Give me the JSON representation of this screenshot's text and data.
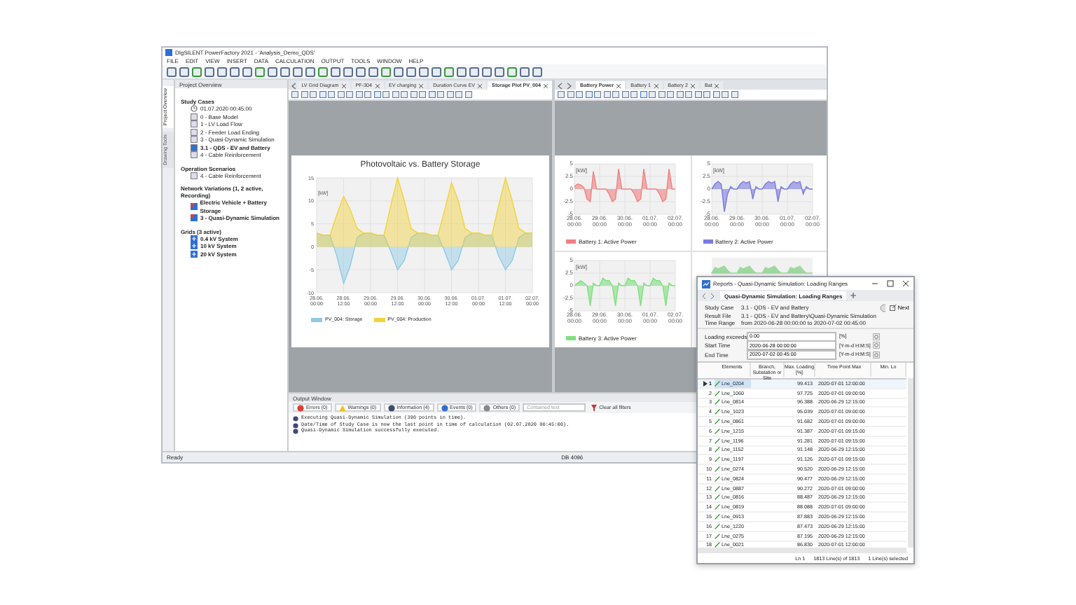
{
  "window": {
    "title": "DIgSILENT PowerFactory 2021 - 'Analysis_Demo_QDS'",
    "menu": [
      "FILE",
      "EDIT",
      "VIEW",
      "INSERT",
      "DATA",
      "CALCULATION",
      "OUTPUT",
      "TOOLS",
      "WINDOW",
      "HELP"
    ]
  },
  "project_overview": {
    "title": "Project Overview",
    "side_tabs": [
      {
        "label": "Project Overview",
        "selected": true
      },
      {
        "label": "Drawing Tools",
        "selected": false
      }
    ],
    "groups": [
      {
        "label": "Study Cases",
        "items": [
          {
            "label": "01.07.2020 00:45:00",
            "kind": "clock",
            "active": false
          },
          {
            "label": "0 - Base Model",
            "kind": "case",
            "active": false
          },
          {
            "label": "1 - LV Load Flow",
            "kind": "case",
            "active": false
          },
          {
            "label": "2 - Feeder Load Ending",
            "kind": "case",
            "active": false
          },
          {
            "label": "3 - Quasi-Dynamic Simulation",
            "kind": "case",
            "active": false
          },
          {
            "label": "3.1 - QDS - EV and Battery",
            "kind": "case",
            "active": true
          },
          {
            "label": "4 - Cable Reinforcement",
            "kind": "case",
            "active": false
          }
        ]
      },
      {
        "label": "Operation Scenarios",
        "items": [
          {
            "label": "4 - Cable Reinforcement",
            "kind": "case",
            "active": false
          }
        ]
      },
      {
        "label": "Network Variations (1, 2 active, Recording)",
        "items": [
          {
            "label": "Electric Vehicle + Battery Storage",
            "kind": "variation",
            "active": true
          },
          {
            "label": "3 - Quasi-Dynamic Simulation",
            "kind": "variation",
            "active": true
          }
        ]
      },
      {
        "label": "Grids (3 active)",
        "items": [
          {
            "label": "0.4 kV System",
            "kind": "grid",
            "active": true
          },
          {
            "label": "10 kV System",
            "kind": "grid",
            "active": true
          },
          {
            "label": "20 kV System",
            "kind": "grid",
            "active": true
          }
        ]
      }
    ]
  },
  "left_pane": {
    "tabs": [
      {
        "label": "LV Grid Diagram",
        "selected": false
      },
      {
        "label": "PF-304",
        "selected": false
      },
      {
        "label": "EV charging",
        "selected": false
      },
      {
        "label": "Duration Curve EV",
        "selected": false
      },
      {
        "label": "Storage Plot PV_004",
        "selected": true
      }
    ],
    "plot": {
      "title": "Photovoltaic vs. Battery Storage",
      "chart_data": {
        "type": "area",
        "grid": true,
        "ylabel": "[kW]",
        "ylim": [
          -10,
          15
        ],
        "yticks": [
          -10,
          -5,
          0,
          5,
          10,
          15
        ],
        "categories": [
          "28.06. 00:00",
          null,
          null,
          null,
          "28.06. 12:00",
          null,
          null,
          null,
          "29.06. 00:00",
          null,
          null,
          null,
          "29.06. 12:00",
          null,
          null,
          null,
          "30.06. 00:00",
          null,
          null,
          null,
          "30.06. 12:00",
          null,
          null,
          null,
          "01.07. 00:00",
          null,
          null,
          null,
          "01.07. 12:00",
          null,
          null,
          null,
          "02.07. 00:00"
        ],
        "series": [
          {
            "name": "PV_004: Storage",
            "color": "#8ecae6",
            "values": [
              3,
              2.5,
              2.5,
              -2,
              -8,
              -4,
              2,
              3,
              3,
              2.5,
              2.5,
              -1,
              -5,
              -3,
              2,
              3,
              3,
              2.5,
              2.5,
              -1,
              -5,
              -3,
              2,
              3,
              3,
              2.5,
              2.5,
              -2,
              -5,
              -3,
              2,
              3,
              3
            ]
          },
          {
            "name": "PV_004: Production",
            "color": "#f2d23c",
            "values": [
              3,
              2.5,
              2.5,
              7,
              11,
              8,
              4,
              3,
              3,
              2.5,
              2.5,
              9,
              15,
              10,
              4,
              3,
              3,
              2.5,
              2.5,
              8,
              14,
              10,
              4,
              3,
              3,
              2.5,
              2.5,
              9,
              15,
              10,
              4,
              3,
              3
            ]
          }
        ]
      }
    }
  },
  "right_pane": {
    "tabs": [
      {
        "label": "Battery Power",
        "selected": true
      },
      {
        "label": "Battery 1",
        "selected": false
      },
      {
        "label": "Battery 2",
        "selected": false
      },
      {
        "label": "Bat",
        "selected": false
      }
    ],
    "plots": [
      {
        "chart_data": {
          "type": "area",
          "grid": true,
          "ylabel": "[kW]",
          "ylim": [
            -5,
            5
          ],
          "yticks": [
            -5,
            -2.5,
            0,
            2.5,
            5
          ],
          "categories": [
            "28.06. 00:00",
            null,
            null,
            null,
            null,
            null,
            null,
            null,
            "29.06. 00:00",
            null,
            null,
            null,
            null,
            null,
            null,
            null,
            "30.06. 00:00",
            null,
            null,
            null,
            null,
            null,
            null,
            null,
            "01.07. 00:00",
            null,
            null,
            null,
            null,
            null,
            null,
            null,
            "02.07. 00:00"
          ],
          "series": [
            {
              "name": "Battery 1: Active Power",
              "color": "#f08080",
              "values": [
                0.5,
                1,
                0.8,
                0.3,
                -2,
                -2.5,
                3.5,
                0,
                0,
                0,
                0,
                -1,
                -2.5,
                -2,
                4,
                0,
                0,
                0,
                0,
                -1,
                -2.5,
                -2,
                4,
                0,
                0,
                0,
                0,
                -1,
                -2.5,
                -2,
                4,
                0,
                0
              ]
            }
          ]
        }
      },
      {
        "chart_data": {
          "type": "area",
          "grid": true,
          "ylabel": "[kW]",
          "ylim": [
            -5,
            5
          ],
          "yticks": [
            -5,
            -2.5,
            0,
            2.5,
            5
          ],
          "categories": [
            "28.06. 00:00",
            null,
            null,
            null,
            null,
            null,
            null,
            null,
            "29.06. 00:00",
            null,
            null,
            null,
            null,
            null,
            null,
            null,
            "30.06. 00:00",
            null,
            null,
            null,
            null,
            null,
            null,
            null,
            "01.07. 00:00",
            null,
            null,
            null,
            null,
            null,
            null,
            null,
            "02.07. 00:00"
          ],
          "series": [
            {
              "name": "Battery 2: Active Power",
              "color": "#7b7be0",
              "values": [
                0,
                1,
                1.5,
                1,
                -4.5,
                -1,
                0.5,
                0,
                0,
                1,
                1.5,
                1.2,
                1.5,
                -2,
                0.5,
                0,
                0,
                1,
                1.5,
                1.2,
                1.5,
                -2.5,
                0.5,
                0,
                0,
                1,
                1.5,
                1.2,
                1.5,
                -1,
                0.5,
                0,
                0
              ]
            }
          ]
        }
      },
      {
        "chart_data": {
          "type": "area",
          "grid": true,
          "ylabel": "[kW]",
          "ylim": [
            -5,
            5
          ],
          "yticks": [
            -5,
            -2.5,
            0,
            2.5,
            5
          ],
          "categories": [
            "28.06. 00:00",
            null,
            null,
            null,
            null,
            null,
            null,
            null,
            "29.06. 00:00",
            null,
            null,
            null,
            null,
            null,
            null,
            null,
            "30.06. 00:00",
            null,
            null,
            null,
            null,
            null,
            null,
            null,
            "01.07. 00:00",
            null,
            null,
            null,
            null,
            null,
            null,
            null,
            "02.07. 00:00"
          ],
          "series": [
            {
              "name": "Battery 3: Active Power",
              "color": "#7ee07e",
              "values": [
                0,
                0.5,
                1,
                0.5,
                0,
                -4,
                0.5,
                0,
                0,
                1.5,
                1,
                1,
                0,
                -4,
                0.5,
                0,
                0,
                1.5,
                1,
                1,
                0,
                -4,
                0.5,
                0,
                0,
                1.5,
                1,
                1,
                0,
                -4,
                0.5,
                0,
                0
              ]
            }
          ]
        }
      }
    ],
    "covered_plot": {
      "color": "#9fd89f"
    }
  },
  "output": {
    "title": "Output Window",
    "filters": [
      {
        "label": "Errors (0)",
        "kind": "error"
      },
      {
        "label": "Warnings (0)",
        "kind": "warning"
      },
      {
        "label": "Information (4)",
        "kind": "info"
      },
      {
        "label": "Events (0)",
        "kind": "event"
      },
      {
        "label": "Others (0)",
        "kind": "other"
      }
    ],
    "search_placeholder": "Contained text",
    "clear_label": "Clear all filters",
    "messages": [
      "Executing Quasi-Dynamic Simulation (390 points in time).",
      "Date/Time of Study Case is now the last point in time of calculation (02.07.2020 00:45:00).",
      "Quasi-Dynamic Simulation successfully executed."
    ]
  },
  "status_bar": {
    "left": "Ready",
    "right": "DB 4096"
  },
  "report": {
    "title": "Reports - Quasi-Dynamic Simulation: Loading Ranges",
    "tab": {
      "label": "Quasi-Dynamic Simulation: Loading Ranges",
      "selected": true
    },
    "next_label": "Next",
    "info": [
      {
        "label": "Study Case",
        "value": "3.1 - QDS - EV and Battery"
      },
      {
        "label": "Result File",
        "value": "3.1 - QDS - EV and Battery\\Quasi-Dynamic Simulation"
      },
      {
        "label": "Time Range",
        "value": "from 2020-06-28 00:00:00 to 2020-07-02 00:45:00"
      }
    ],
    "fields": [
      {
        "label": "Loading exceeds",
        "value": "0.00",
        "unit": "[%]"
      },
      {
        "label": "Start Time",
        "value": "2020-06-28 00:00:00",
        "unit": "[Y-m-d H:M:S]"
      },
      {
        "label": "End Time",
        "value": "2020-07-02 00:45:00",
        "unit": "[Y-m-d H:M:S]"
      }
    ],
    "columns": [
      "Elements",
      "Branch, Substation or Site",
      "Max. Loading [%]",
      "Time Point Max",
      "Min. Lo"
    ],
    "rows": [
      {
        "n": "1",
        "element": "Lne_0204",
        "max": "99.413",
        "time": "2020-07-01 12:00:00",
        "selected": true
      },
      {
        "n": "2",
        "element": "Lne_1060",
        "max": "97.725",
        "time": "2020-07-01 09:00:00",
        "selected": false
      },
      {
        "n": "3",
        "element": "Lne_0814",
        "max": "96.388",
        "time": "2020-06-29 12:15:00",
        "selected": false
      },
      {
        "n": "4",
        "element": "Lne_1023",
        "max": "95.039",
        "time": "2020-07-01 09:00:00",
        "selected": false
      },
      {
        "n": "5",
        "element": "Lne_0861",
        "max": "91.682",
        "time": "2020-07-01 09:00:00",
        "selected": false
      },
      {
        "n": "6",
        "element": "Lne_1215",
        "max": "91.387",
        "time": "2020-07-01 09:15:00",
        "selected": false
      },
      {
        "n": "7",
        "element": "Lne_1196",
        "max": "91.281",
        "time": "2020-07-01 09:15:00",
        "selected": false
      },
      {
        "n": "8",
        "element": "Lne_1152",
        "max": "91.148",
        "time": "2020-06-29 12:15:00",
        "selected": false
      },
      {
        "n": "9",
        "element": "Lne_1197",
        "max": "91.126",
        "time": "2020-07-01 09:15:00",
        "selected": false
      },
      {
        "n": "10",
        "element": "Lne_0274",
        "max": "90.520",
        "time": "2020-06-29 12:15:00",
        "selected": false
      },
      {
        "n": "11",
        "element": "Lne_0824",
        "max": "90.477",
        "time": "2020-06-29 12:15:00",
        "selected": false
      },
      {
        "n": "12",
        "element": "Lne_0887",
        "max": "90.272",
        "time": "2020-07-01 09:00:00",
        "selected": false
      },
      {
        "n": "13",
        "element": "Lne_0816",
        "max": "88.487",
        "time": "2020-06-29 12:15:00",
        "selected": false
      },
      {
        "n": "14",
        "element": "Lne_0819",
        "max": "88.088",
        "time": "2020-07-01 09:00:00",
        "selected": false
      },
      {
        "n": "15",
        "element": "Lne_0913",
        "max": "87.883",
        "time": "2020-06-29 12:15:00",
        "selected": false
      },
      {
        "n": "16",
        "element": "Lne_1220",
        "max": "87.473",
        "time": "2020-06-29 12:15:00",
        "selected": false
      },
      {
        "n": "17",
        "element": "Lne_0275",
        "max": "87.195",
        "time": "2020-06-29 12:15:00",
        "selected": false
      },
      {
        "n": "18",
        "element": "Lne_0021",
        "max": "86.830",
        "time": "2020-07-01 12:00:00",
        "selected": false
      }
    ],
    "status": [
      "Ln 1",
      "1813 Line(s) of 1813",
      "1 Line(s) selected"
    ]
  }
}
